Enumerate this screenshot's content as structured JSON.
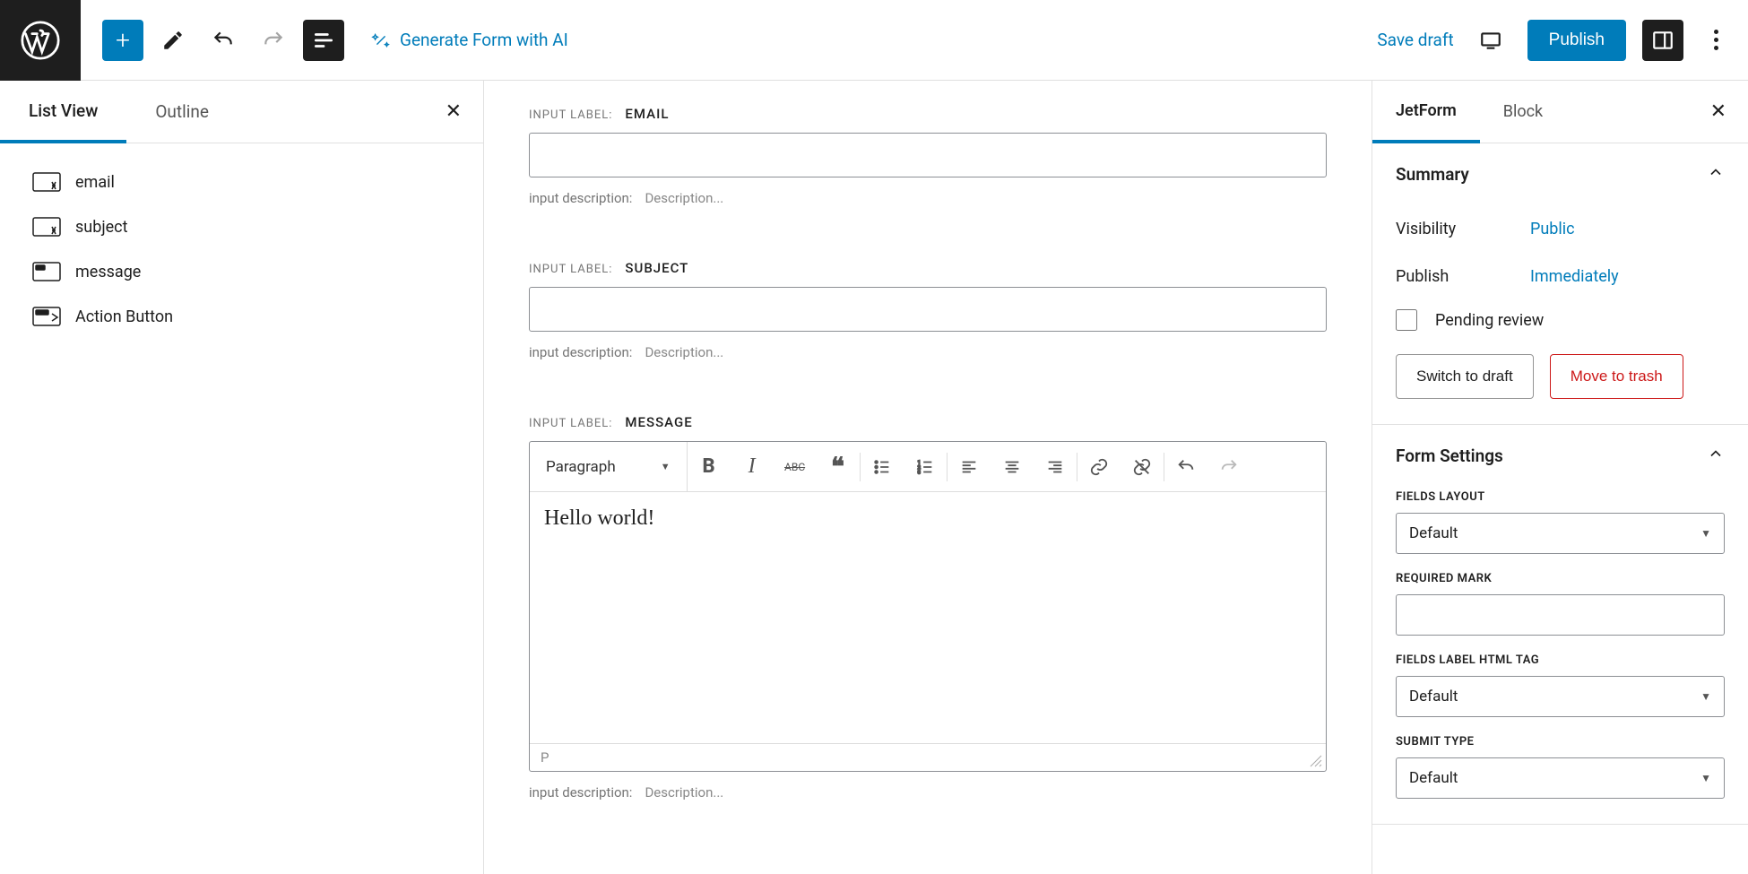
{
  "topbar": {
    "generate_ai": "Generate Form with AI",
    "save_draft": "Save draft",
    "publish": "Publish"
  },
  "left": {
    "tabs": {
      "list_view": "List View",
      "outline": "Outline"
    },
    "items": [
      {
        "label": "email",
        "icon": "text-field"
      },
      {
        "label": "subject",
        "icon": "text-field"
      },
      {
        "label": "message",
        "icon": "wysiwyg"
      },
      {
        "label": "Action Button",
        "icon": "action-button"
      }
    ]
  },
  "canvas": {
    "label_prefix": "INPUT LABEL:",
    "desc_prefix": "input description:",
    "desc_placeholder": "Description...",
    "fields": [
      {
        "label": "EMAIL",
        "value": ""
      },
      {
        "label": "SUBJECT",
        "value": ""
      }
    ],
    "message": {
      "label": "MESSAGE",
      "format_selector": "Paragraph",
      "content": "Hello world!",
      "status_path": "P"
    }
  },
  "right": {
    "tabs": {
      "jetform": "JetForm",
      "block": "Block"
    },
    "summary": {
      "title": "Summary",
      "visibility_label": "Visibility",
      "visibility_value": "Public",
      "publish_label": "Publish",
      "publish_value": "Immediately",
      "pending_review": "Pending review",
      "switch_draft": "Switch to draft",
      "move_trash": "Move to trash"
    },
    "form_settings": {
      "title": "Form Settings",
      "fields_layout_label": "FIELDS LAYOUT",
      "fields_layout_value": "Default",
      "required_mark_label": "REQUIRED MARK",
      "required_mark_value": "",
      "fields_label_tag_label": "FIELDS LABEL HTML TAG",
      "fields_label_tag_value": "Default",
      "submit_type_label": "SUBMIT TYPE",
      "submit_type_value": "Default"
    }
  }
}
